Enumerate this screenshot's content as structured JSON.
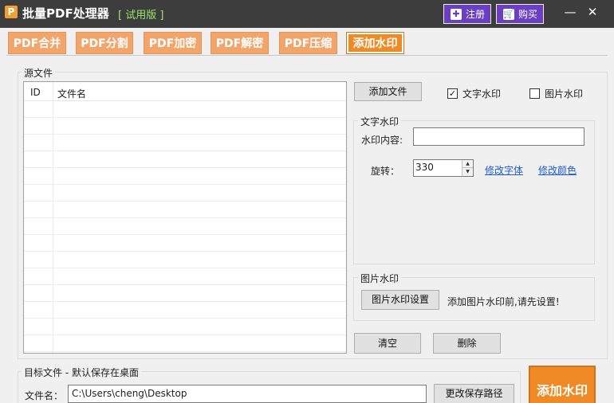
{
  "titlebar": {
    "logo_letter": "P",
    "title": "批量PDF处理器",
    "trial_badge": "[ 试用版 ]",
    "register_label": "注册",
    "buy_label": "购买",
    "minimize_glyph": "—",
    "close_glyph": "✕"
  },
  "tabs": [
    {
      "label": "PDF合并",
      "active": false
    },
    {
      "label": "PDF分割",
      "active": false
    },
    {
      "label": "PDF加密",
      "active": false
    },
    {
      "label": "PDF解密",
      "active": false
    },
    {
      "label": "PDF压缩",
      "active": false
    },
    {
      "label": "添加水印",
      "active": true
    }
  ],
  "source": {
    "legend": "源文件",
    "columns": [
      "ID",
      "文件名"
    ],
    "rows": []
  },
  "controls": {
    "add_file_label": "添加文件",
    "text_watermark_check": "文字水印",
    "text_watermark_checked": true,
    "image_watermark_check": "图片水印",
    "image_watermark_checked": false
  },
  "text_watermark": {
    "legend": "文字水印",
    "content_label": "水印内容:",
    "content_value": "",
    "rotation_label": "旋转：",
    "rotation_value": "330",
    "change_font_link": "修改字体",
    "change_color_link": "修改颜色"
  },
  "image_watermark": {
    "legend": "图片水印",
    "settings_button": "图片水印设置",
    "hint": "添加图片水印前,请先设置!"
  },
  "actions": {
    "clear_label": "清空",
    "delete_label": "删除"
  },
  "target": {
    "legend": "目标文件 - 默认保存在桌面",
    "filename_label": "文件名：",
    "path_value": "C:\\Users\\cheng\\Desktop",
    "change_path_button": "更改保存路径",
    "submit_label": "添加水印"
  },
  "colors": {
    "titlebar_bg": "#3d3d3d",
    "tab_inactive": "#f1a56b",
    "tab_active": "#f08a24",
    "purple_button": "#6a3fc4",
    "trial_green": "#9be870",
    "link_blue": "#1e5bd6"
  },
  "icons": {
    "register": "plus-circle-icon",
    "buy": "cart-icon",
    "logo": "app-logo-icon"
  }
}
